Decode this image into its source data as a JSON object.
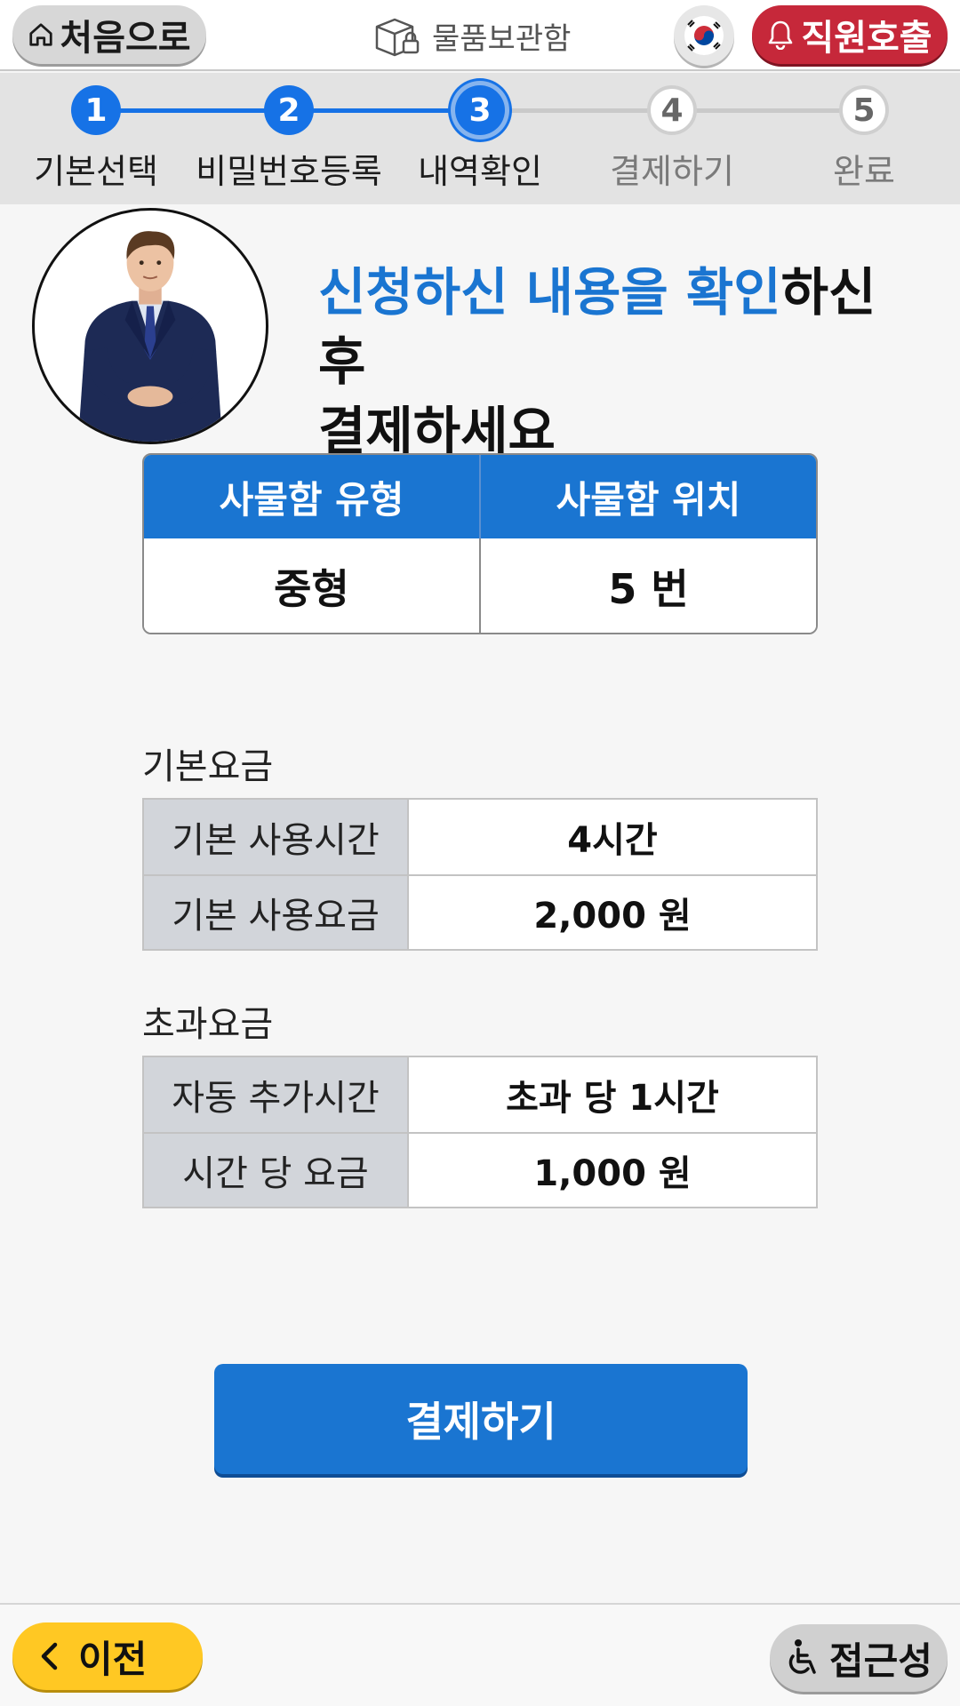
{
  "header": {
    "home_label": "처음으로",
    "service_title": "물품보관함",
    "call_label": "직원호출"
  },
  "stepper": {
    "steps": [
      {
        "number": "1",
        "label": "기본선택",
        "state": "done"
      },
      {
        "number": "2",
        "label": "비밀번호등록",
        "state": "done"
      },
      {
        "number": "3",
        "label": "내역확인",
        "state": "current"
      },
      {
        "number": "4",
        "label": "결제하기",
        "state": "todo"
      },
      {
        "number": "5",
        "label": "완료",
        "state": "todo"
      }
    ]
  },
  "main": {
    "heading_highlight": "신청하신 내용을 확인",
    "heading_rest_line1": "하신 후",
    "heading_line2": "결제하세요",
    "locker": {
      "type_header": "사물함 유형",
      "location_header": "사물함 위치",
      "type_value": "중형",
      "location_value": "5 번"
    },
    "basic_fee": {
      "title": "기본요금",
      "rows": [
        {
          "key": "기본 사용시간",
          "value": "4시간"
        },
        {
          "key": "기본 사용요금",
          "value": "2,000 원"
        }
      ]
    },
    "extra_fee": {
      "title": "초과요금",
      "rows": [
        {
          "key": "자동 추가시간",
          "value": "초과 당 1시간"
        },
        {
          "key": "시간 당 요금",
          "value": "1,000 원"
        }
      ]
    },
    "pay_label": "결제하기"
  },
  "footer": {
    "prev_label": "이전",
    "access_label": "접근성"
  },
  "colors": {
    "primary_blue": "#1a75d1",
    "call_red": "#c6283a",
    "prev_yellow": "#ffc823"
  },
  "icons": {
    "home": "home-icon",
    "locker": "locker-icon",
    "flag": "korea-flag-icon",
    "bell": "bell-icon",
    "back": "chevron-left-icon",
    "accessibility": "wheelchair-icon"
  }
}
